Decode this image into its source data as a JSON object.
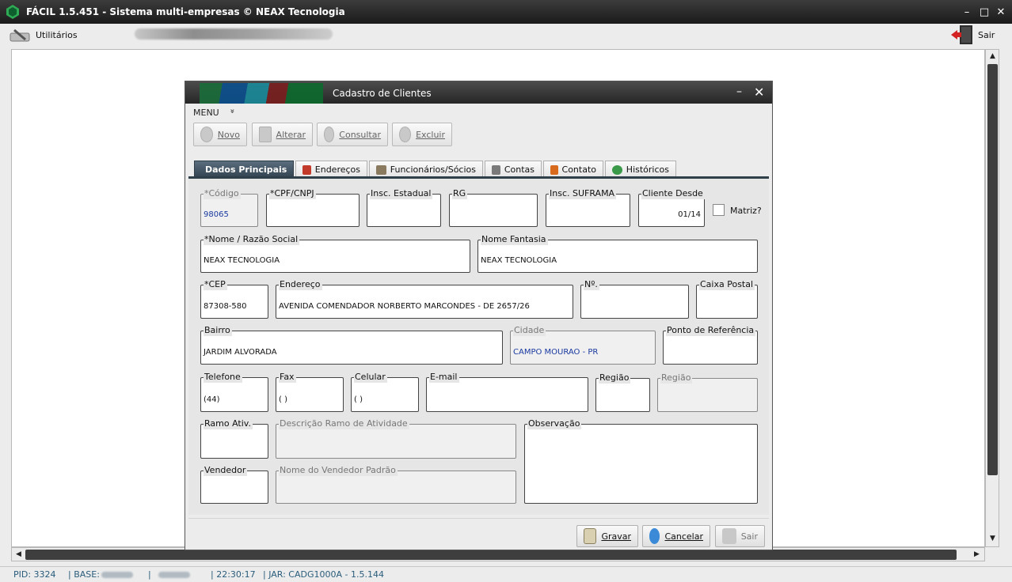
{
  "window": {
    "title": "FÁCIL 1.5.451 - Sistema multi-empresas © NEAX Tecnologia"
  },
  "toolbar": {
    "utilities_label": "Utilitários",
    "exit_label": "Sair"
  },
  "dialog": {
    "title": "Cadastro de Clientes",
    "menu_label": "MENU",
    "menu_chevron": "»",
    "buttons": {
      "new": "Novo",
      "edit": "Alterar",
      "search": "Consultar",
      "delete": "Excluir"
    },
    "tabs": [
      "Dados Principais",
      "Endereços",
      "Funcionários/Sócios",
      "Contas",
      "Contato",
      "Históricos"
    ],
    "fields": {
      "codigo": {
        "label": "*Código",
        "value": "98065"
      },
      "cpf_cnpj": {
        "label": "*CPF/CNPJ",
        "value": ""
      },
      "insc_estadual": {
        "label": "Insc. Estadual",
        "value": ""
      },
      "rg": {
        "label": "RG",
        "value": ""
      },
      "insc_suframa": {
        "label": "Insc. SUFRAMA",
        "value": ""
      },
      "cliente_desde": {
        "label": "Cliente Desde",
        "value": "01/14"
      },
      "matriz": {
        "label": "Matriz?"
      },
      "nome": {
        "label": "*Nome / Razão Social",
        "value": "NEAX TECNOLOGIA"
      },
      "fantasia": {
        "label": "Nome Fantasia",
        "value": "NEAX TECNOLOGIA"
      },
      "cep": {
        "label": "*CEP",
        "value": "87308-580"
      },
      "endereco": {
        "label": "Endereço",
        "value": "AVENIDA COMENDADOR NORBERTO MARCONDES - DE 2657/26"
      },
      "numero": {
        "label": "Nº.",
        "value": ""
      },
      "caixa_postal": {
        "label": "Caixa Postal",
        "value": ""
      },
      "bairro": {
        "label": "Bairro",
        "value": "JARDIM ALVORADA"
      },
      "cidade": {
        "label": "Cidade",
        "value": "CAMPO MOURAO - PR"
      },
      "ponto_ref": {
        "label": "Ponto de Referência",
        "value": ""
      },
      "telefone": {
        "label": "Telefone",
        "value": "(44)"
      },
      "fax": {
        "label": "Fax",
        "value": "(  )"
      },
      "celular": {
        "label": "Celular",
        "value": "(  )"
      },
      "email": {
        "label": "E-mail",
        "value": ""
      },
      "regiao": {
        "label": "Região",
        "value": ""
      },
      "regiao_desc": {
        "label": "Região",
        "value": ""
      },
      "ramo": {
        "label": "Ramo Ativ.",
        "value": ""
      },
      "ramo_desc": {
        "label": "Descrição Ramo de Atividade",
        "value": ""
      },
      "observacao": {
        "label": "Observação",
        "value": ""
      },
      "vendedor": {
        "label": "Vendedor",
        "value": ""
      },
      "vendedor_nome": {
        "label": "Nome do Vendedor Padrão",
        "value": ""
      }
    },
    "footer": {
      "save": "Gravar",
      "cancel": "Cancelar",
      "exit": "Sair"
    }
  },
  "status": {
    "pid": "PID: 3324",
    "base": "| BASE:",
    "sep": "|",
    "time": "|  22:30:17",
    "jar": "|  JAR: CADG1000A - 1.5.144"
  }
}
